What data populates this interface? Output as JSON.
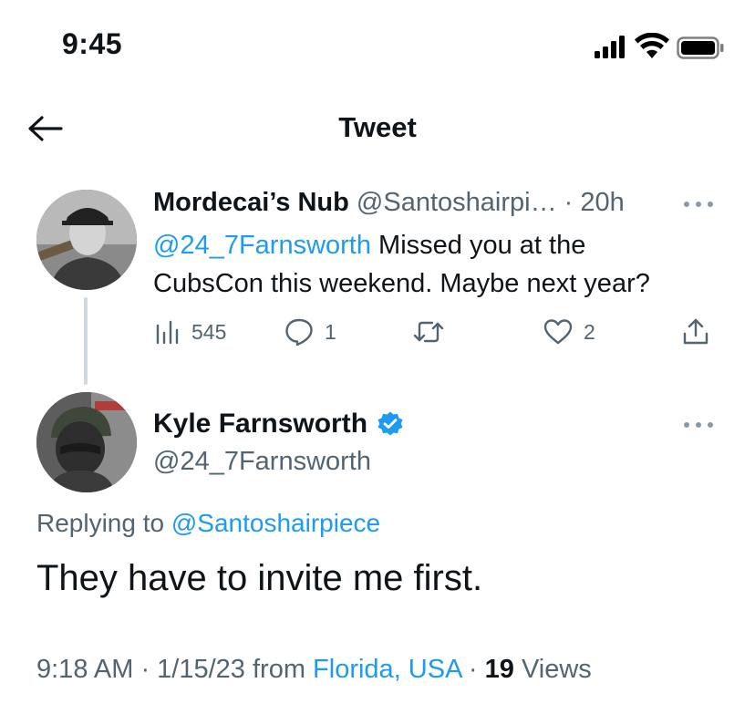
{
  "status_bar": {
    "time": "9:45",
    "icons": [
      "cellular-signal-icon",
      "wifi-icon",
      "battery-icon"
    ]
  },
  "nav": {
    "back_icon": "arrow-left-icon",
    "title": "Tweet"
  },
  "parent_tweet": {
    "name": "Mordecai’s Nub",
    "handle": "@Santoshairpi…",
    "separator": "·",
    "time": "20h",
    "mention": "@24_7Farnsworth",
    "text_line1": " Missed you at the",
    "text_line2": "CubsCon this weekend.  Maybe next year?",
    "stats": {
      "views": "545",
      "replies": "1",
      "retweets": "",
      "likes": "2"
    }
  },
  "main_tweet": {
    "name": "Kyle Farnsworth",
    "verified_icon": "verified-badge-icon",
    "handle": "@24_7Farnsworth",
    "replying_prefix": "Replying to ",
    "replying_to": "@Santoshairpiece",
    "text": "They have to invite me first.",
    "timestamp": "9:18 AM · 1/15/23 from ",
    "location": "Florida, USA",
    "views_sep": " · ",
    "views_count": "19",
    "views_label": " Views"
  },
  "colors": {
    "accent": "#1d9bf0",
    "text": "#0f1419",
    "secondary": "#536471",
    "thread_line": "#cfd9de"
  }
}
